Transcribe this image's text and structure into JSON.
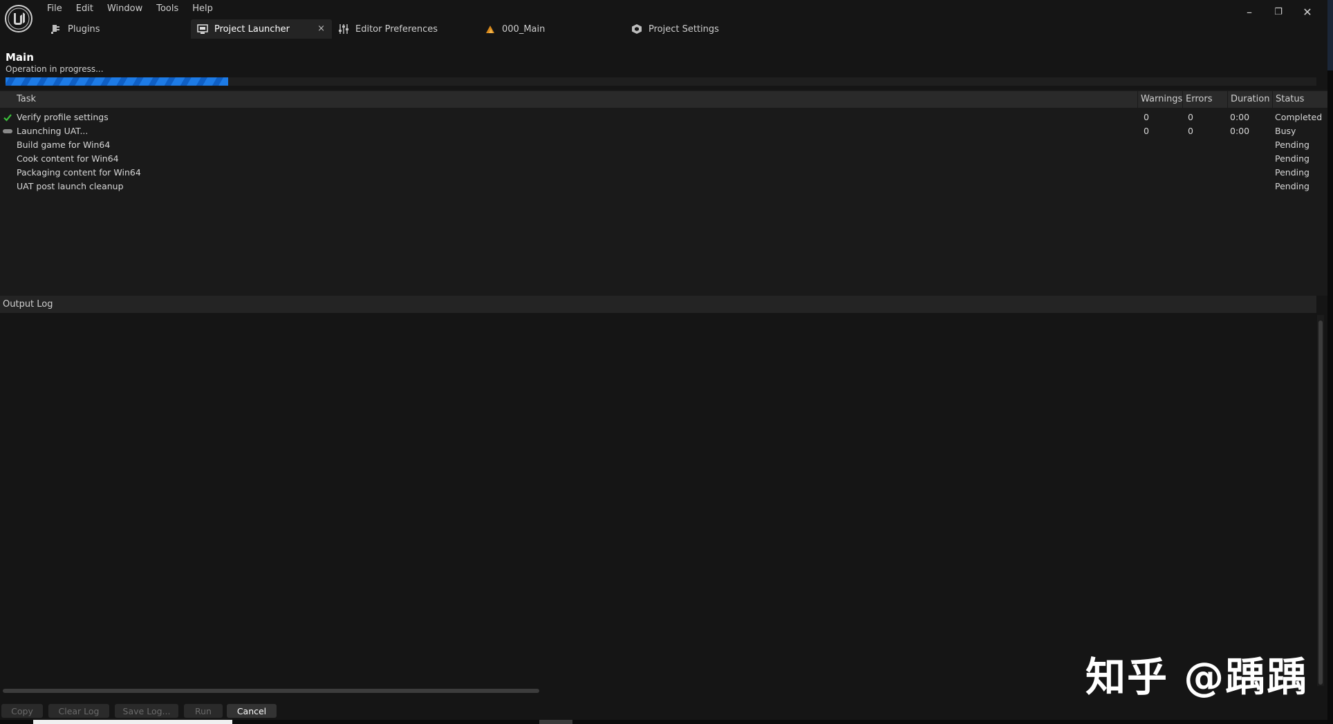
{
  "menu": [
    "File",
    "Edit",
    "Window",
    "Tools",
    "Help"
  ],
  "tabs": [
    {
      "label": "Plugins",
      "icon": "plug-icon"
    },
    {
      "label": "Project Launcher",
      "icon": "launcher-icon",
      "active": true,
      "close": "×"
    },
    {
      "label": "Editor Preferences",
      "icon": "sliders-icon"
    },
    {
      "label": "000_Main",
      "icon": "level-icon"
    },
    {
      "label": "Project Settings",
      "icon": "settings-cube-icon"
    }
  ],
  "window_controls": {
    "minimize": "–",
    "restore": "❐",
    "close": "✕"
  },
  "profile": {
    "name": "Main",
    "status": "Operation in progress...",
    "progress": 0.17
  },
  "task_columns": {
    "task": "Task",
    "warnings": "Warnings",
    "errors": "Errors",
    "duration": "Duration",
    "status": "Status"
  },
  "tasks": [
    {
      "name": "Verify profile settings",
      "warnings": "0",
      "errors": "0",
      "duration": "0:00",
      "status": "Completed",
      "state": "done"
    },
    {
      "name": "Launching UAT...",
      "warnings": "0",
      "errors": "0",
      "duration": "0:00",
      "status": "Busy",
      "state": "busy"
    },
    {
      "name": "Build game for Win64",
      "warnings": "",
      "errors": "",
      "duration": "",
      "status": "Pending",
      "state": "pending"
    },
    {
      "name": "Cook content for Win64",
      "warnings": "",
      "errors": "",
      "duration": "",
      "status": "Pending",
      "state": "pending"
    },
    {
      "name": "Packaging content for Win64",
      "warnings": "",
      "errors": "",
      "duration": "",
      "status": "Pending",
      "state": "pending"
    },
    {
      "name": "UAT post launch cleanup",
      "warnings": "",
      "errors": "",
      "duration": "",
      "status": "Pending",
      "state": "pending"
    }
  ],
  "log": {
    "title": "Output Log"
  },
  "buttons": {
    "copy": "Copy",
    "clear_log": "Clear Log",
    "save_log": "Save Log...",
    "run": "Run",
    "cancel": "Cancel"
  },
  "watermark": "知乎 @踽踽",
  "colors": {
    "accent_blue": "#1d7be6",
    "check_green": "#3bbf3b"
  }
}
